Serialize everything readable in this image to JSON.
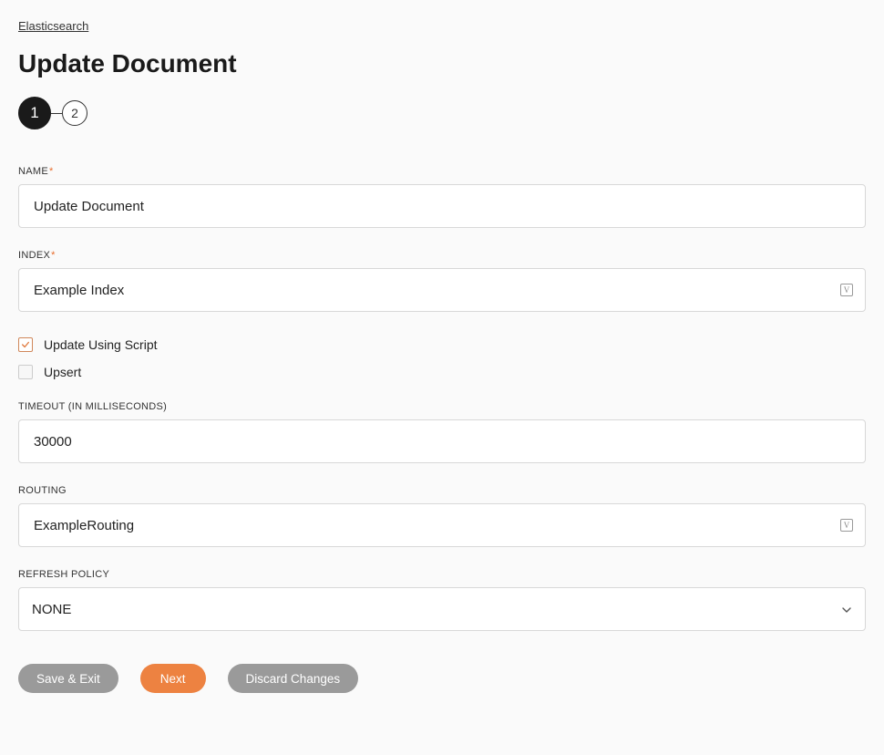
{
  "breadcrumb": "Elasticsearch",
  "title": "Update Document",
  "stepper": {
    "current": "1",
    "next": "2"
  },
  "fields": {
    "name": {
      "label": "NAME",
      "value": "Update Document",
      "required": true
    },
    "index": {
      "label": "INDEX",
      "value": "Example Index",
      "required": true
    },
    "timeout": {
      "label": "TIMEOUT (IN MILLISECONDS)",
      "value": "30000"
    },
    "routing": {
      "label": "ROUTING",
      "value": "ExampleRouting"
    },
    "refresh": {
      "label": "REFRESH POLICY",
      "value": "NONE"
    }
  },
  "checkboxes": {
    "updateScript": {
      "label": "Update Using Script",
      "checked": true
    },
    "upsert": {
      "label": "Upsert",
      "checked": false
    }
  },
  "buttons": {
    "saveExit": "Save & Exit",
    "next": "Next",
    "discard": "Discard Changes"
  },
  "requiredMark": "*"
}
